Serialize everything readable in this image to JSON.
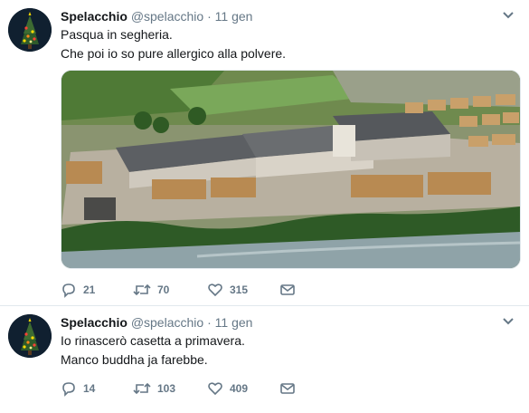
{
  "tweets": [
    {
      "author": {
        "name": "Spelacchio",
        "handle": "@spelacchio",
        "time": "11 gen"
      },
      "text_lines": [
        "Pasqua in segheria.",
        "Che poi io so pure allergico alla polvere."
      ],
      "media": {
        "description_icon": "photo-sawmill-aerial",
        "present": true
      },
      "actions": {
        "replies": "21",
        "retweets": "70",
        "likes": "315"
      }
    },
    {
      "author": {
        "name": "Spelacchio",
        "handle": "@spelacchio",
        "time": "11 gen"
      },
      "text_lines": [
        "Io rinascerò casetta a primavera.",
        "Manco buddha ja farebbe."
      ],
      "actions": {
        "replies": "14",
        "retweets": "103",
        "likes": "409"
      }
    }
  ],
  "separator": "·",
  "colors": {
    "text_primary": "#14171a",
    "text_secondary": "#657786",
    "border": "#e1e8ed",
    "background": "#e6ecf0"
  }
}
